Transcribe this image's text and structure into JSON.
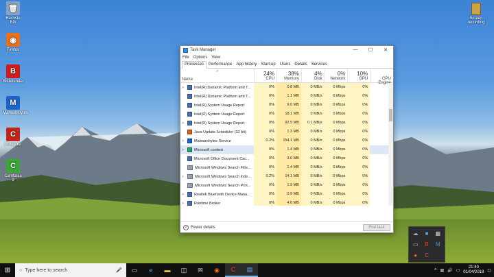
{
  "desktop": {
    "icons": [
      {
        "label": "Recycle Bin",
        "glyph": "🗑",
        "color": "#8aa2c0"
      },
      {
        "label": "Firefox",
        "glyph": "◉",
        "color": "#e8721c"
      },
      {
        "label": "Bitdefender",
        "glyph": "B",
        "color": "#d11c1c"
      },
      {
        "label": "Malwarebytes",
        "glyph": "M",
        "color": "#1d62c4"
      },
      {
        "label": "CCleaner",
        "glyph": "C",
        "color": "#c0261b"
      },
      {
        "label": "Camtasia 9",
        "glyph": "C",
        "color": "#3aa635"
      }
    ],
    "screen_recording_label": "Screen recording"
  },
  "task_manager": {
    "title": "Task Manager",
    "menu": [
      "File",
      "Options",
      "View"
    ],
    "tabs": [
      "Processes",
      "Performance",
      "App history",
      "Start-up",
      "Users",
      "Details",
      "Services"
    ],
    "active_tab": "Processes",
    "columns": {
      "name": "Name",
      "cpu": {
        "pct": "24%",
        "label": "CPU"
      },
      "memory": {
        "pct": "38%",
        "label": "Memory"
      },
      "disk": {
        "pct": "4%",
        "label": "Disk"
      },
      "network": {
        "pct": "0%",
        "label": "Network"
      },
      "gpu": {
        "pct": "10%",
        "label": "GPU"
      },
      "gpu_engine": {
        "label": "GPU Engine"
      }
    },
    "rows": [
      {
        "name": "Intel(R) Dynamic Platform and T...",
        "exp": ">",
        "icon": "default",
        "cpu": "0%",
        "mem": "0.8 MB",
        "disk": "0 MB/s",
        "net": "0 Mbps",
        "gpu": "0%"
      },
      {
        "name": "Intel(R) Dynamic Platform and T...",
        "exp": "",
        "icon": "default",
        "cpu": "0%",
        "mem": "1.1 MB",
        "disk": "0 MB/s",
        "net": "0 Mbps",
        "gpu": "0%"
      },
      {
        "name": "Intel(R) System Usage Report",
        "exp": "",
        "icon": "default",
        "cpu": "0%",
        "mem": "9.0 MB",
        "disk": "0 MB/s",
        "net": "0 Mbps",
        "gpu": "0%"
      },
      {
        "name": "Intel(R) System Usage Report",
        "exp": "",
        "icon": "default",
        "cpu": "0%",
        "mem": "18.1 MB",
        "disk": "0 MB/s",
        "net": "0 Mbps",
        "gpu": "0%"
      },
      {
        "name": "Intel(R) System Usage Report",
        "exp": ">",
        "icon": "default",
        "cpu": "0%",
        "mem": "92.5 MB",
        "disk": "0.1 MB/s",
        "net": "0 Mbps",
        "gpu": "0%"
      },
      {
        "name": "Java Update Scheduler (32 bit)",
        "exp": "",
        "icon": "java",
        "cpu": "0%",
        "mem": "1.3 MB",
        "disk": "0 MB/s",
        "net": "0 Mbps",
        "gpu": "0%"
      },
      {
        "name": "Malwarebytes Service",
        "exp": ">",
        "icon": "mb",
        "cpu": "0.2%",
        "mem": "154.1 MB",
        "disk": "0 MB/s",
        "net": "0 Mbps",
        "gpu": "0%"
      },
      {
        "name": "Microsoft content",
        "exp": ">",
        "icon": "ms",
        "cpu": "0%",
        "mem": "1.4 MB",
        "disk": "0 MB/s",
        "net": "0 Mbps",
        "gpu": "0%"
      },
      {
        "name": "Microsoft Office Document Cac...",
        "exp": "",
        "icon": "default",
        "cpu": "0%",
        "mem": "3.0 MB",
        "disk": "0 MB/s",
        "net": "0 Mbps",
        "gpu": "0%"
      },
      {
        "name": "Microsoft Windows Search Filte...",
        "exp": "",
        "icon": "search",
        "cpu": "0%",
        "mem": "1.4 MB",
        "disk": "0 MB/s",
        "net": "0 Mbps",
        "gpu": "0%"
      },
      {
        "name": "Microsoft Windows Search Inde...",
        "exp": ">",
        "icon": "search",
        "cpu": "0.2%",
        "mem": "14.1 MB",
        "disk": "0 MB/s",
        "net": "0 Mbps",
        "gpu": "0%"
      },
      {
        "name": "Microsoft Windows Search Prot...",
        "exp": "",
        "icon": "search",
        "cpu": "0%",
        "mem": "1.9 MB",
        "disk": "0 MB/s",
        "net": "0 Mbps",
        "gpu": "0%"
      },
      {
        "name": "Realtek Bluetooth Device Mana...",
        "exp": ">",
        "icon": "default",
        "cpu": "0%",
        "mem": "0.9 MB",
        "disk": "0 MB/s",
        "net": "0 Mbps",
        "gpu": "0%"
      },
      {
        "name": "Runtime Broker",
        "exp": ">",
        "icon": "default",
        "cpu": "0%",
        "mem": "4.0 MB",
        "disk": "0 MB/s",
        "net": "0 Mbps",
        "gpu": "0%"
      }
    ],
    "footer": {
      "fewer_details": "Fewer details",
      "end_task": "End task"
    }
  },
  "taskbar": {
    "search_placeholder": "Type here to search",
    "time": "21:40",
    "date": "01/04/2018"
  }
}
